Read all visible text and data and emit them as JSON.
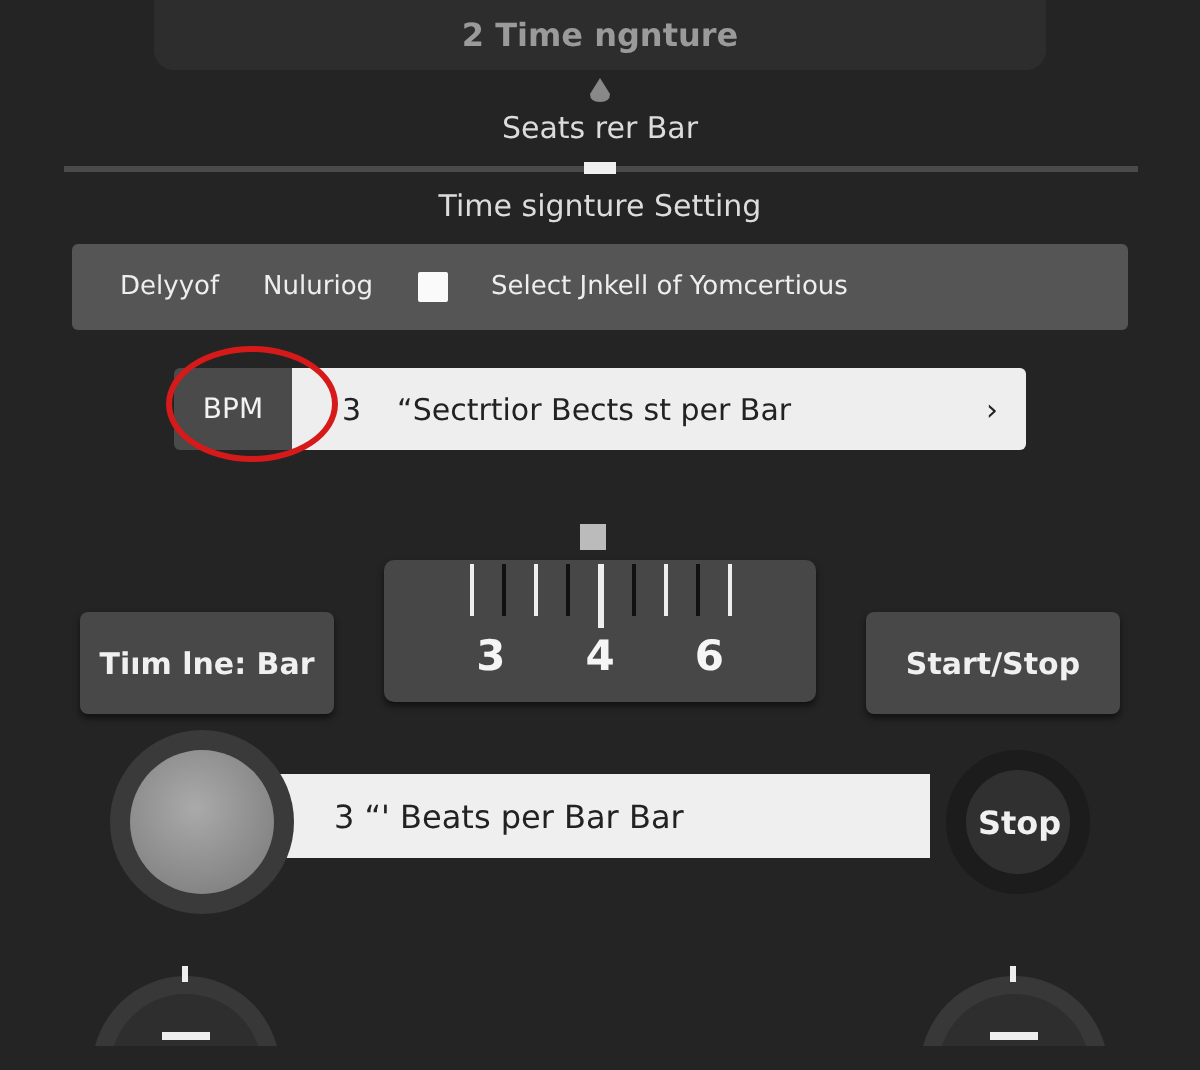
{
  "header": {
    "title": "2 Time ngnture"
  },
  "beats_label": "Seats rer Bar",
  "beats_slider": {
    "level": 0.5
  },
  "section_title": "Time signture Setting",
  "options_bar": {
    "items": [
      {
        "kind": "text",
        "label": "Delyyof"
      },
      {
        "kind": "text",
        "label": "Nuluriog"
      },
      {
        "kind": "checkbox",
        "checked": false
      },
      {
        "kind": "text",
        "label": "Select Jnkell of Yomcertious"
      }
    ]
  },
  "bpm_row": {
    "tag": "BPM",
    "value": "3",
    "text": "“Sectrtior Bects st per Bar",
    "chevron": "›",
    "highlighted": true
  },
  "ruler": {
    "labels": [
      "3",
      "4",
      "6"
    ]
  },
  "left_button": "Tiım lne: Bar",
  "right_button": "Start/Stop",
  "transport": {
    "text": "3 “' Beats per Bar Bar",
    "stop": "Stop"
  }
}
